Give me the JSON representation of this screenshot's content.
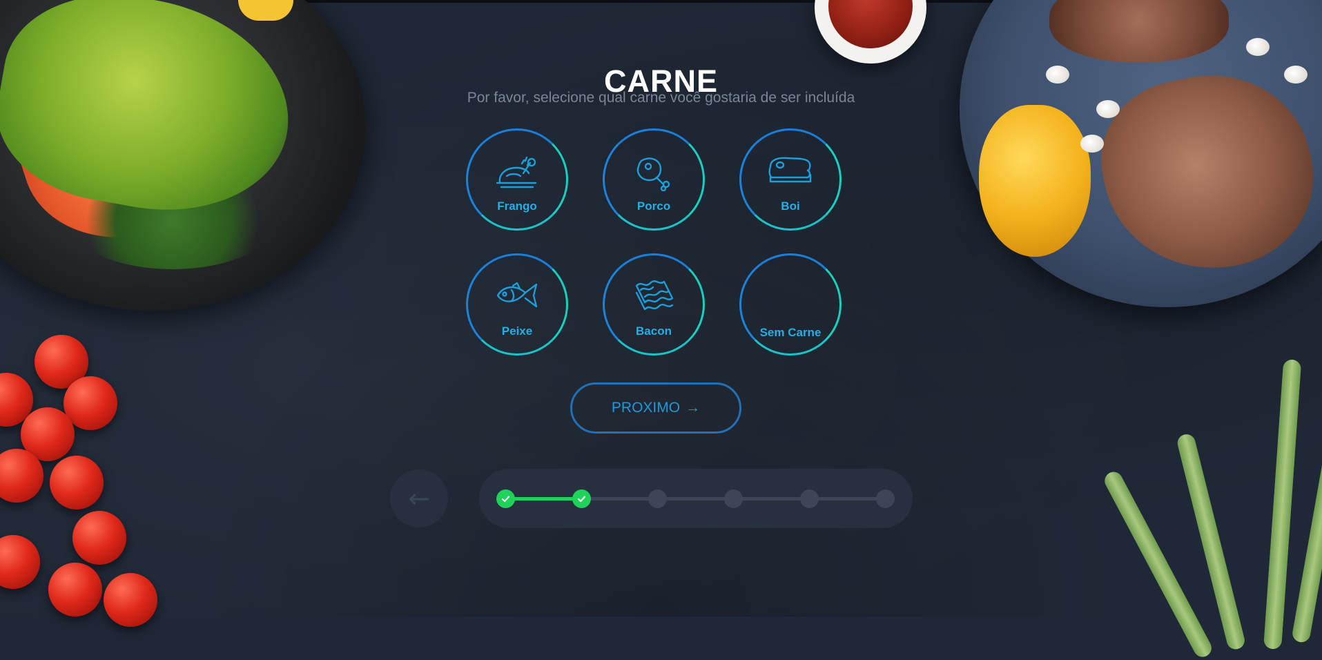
{
  "page": {
    "title": "CARNE",
    "subtitle": "Por favor, selecione qual carne você gostaria de ser incluída"
  },
  "options": [
    {
      "id": "frango",
      "label": "Frango",
      "icon": "chicken-icon"
    },
    {
      "id": "porco",
      "label": "Porco",
      "icon": "ham-icon"
    },
    {
      "id": "boi",
      "label": "Boi",
      "icon": "steak-icon"
    },
    {
      "id": "peixe",
      "label": "Peixe",
      "icon": "fish-icon"
    },
    {
      "id": "bacon",
      "label": "Bacon",
      "icon": "bacon-icon"
    },
    {
      "id": "sem-carne",
      "label": "Sem Carne",
      "icon": ""
    }
  ],
  "next_button": {
    "label": "PROXIMO",
    "arrow": "→"
  },
  "back_button": {
    "arrow": "←"
  },
  "progress": {
    "total_steps": 6,
    "completed_steps": 2
  },
  "colors": {
    "background": "#1f2836",
    "accent_blue": "#23b0e6",
    "accent_teal": "#19d0c0",
    "progress_done": "#1fd35a",
    "progress_pending": "#3c4658"
  }
}
